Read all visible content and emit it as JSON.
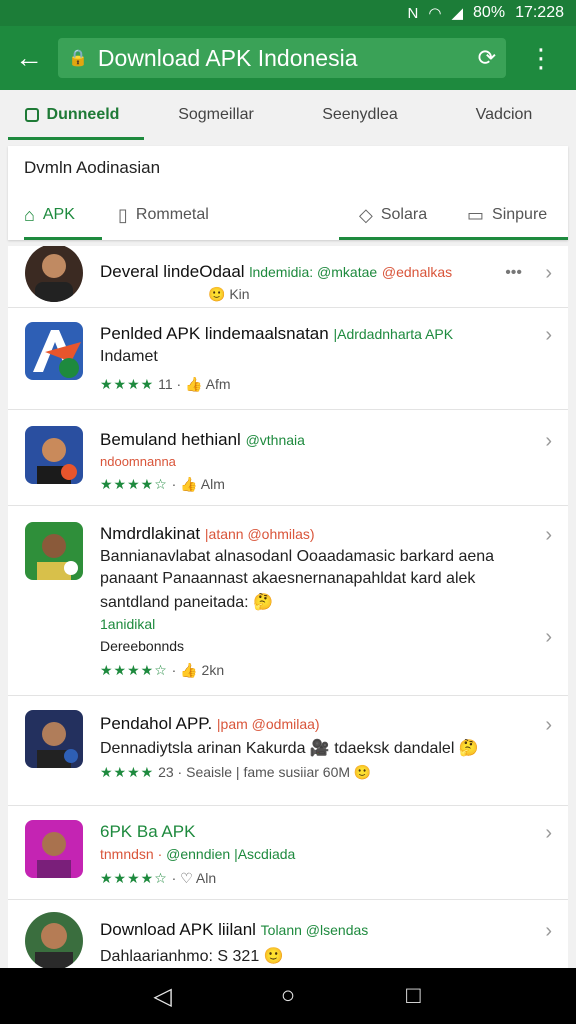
{
  "status": {
    "battery": "80%",
    "time": "17:228"
  },
  "toolbar": {
    "url": "Download APK Indonesia"
  },
  "top_tabs": [
    "Dunneeld",
    "Sogmeillar",
    "Seenydlea",
    "Vadcion"
  ],
  "card": {
    "title": "Dvmln Aodinasian",
    "sub_tabs": [
      "APK",
      "Rommetal",
      "Solara",
      "Sinpure"
    ]
  },
  "items": [
    {
      "title": "Deveral lindeOdaal",
      "dev": "lndemidia: @mkatae",
      "dev2": "@ednalkas",
      "meta": "Kin"
    },
    {
      "title": "Penlded APK lindemaalsnatan",
      "dev": "|Adrdadnharta APK",
      "desc": "Indamet",
      "stars": "★★★★",
      "rating": "11 ·",
      "meta": "Afm"
    },
    {
      "title": "Bemuland hethianl",
      "dev": "@vthnaia",
      "red": "ndoomnanna",
      "stars": "★★★★☆",
      "rating": "·",
      "meta": "Alm"
    },
    {
      "title": "Nmdrdlakinat",
      "dev2": "|atann @ohmilas)",
      "desc1": "Bannianavlabat alnasodanl Ooaadamasic barkard aena",
      "desc2": "panaant Panaannast akaesnernanapahldat kard alek",
      "desc3": "santdland paneitada:",
      "green": "1anidikal",
      "desc4": "Dereebonnds",
      "stars": "★★★★☆",
      "rating": "·",
      "meta": "2kn"
    },
    {
      "title": "Pendahol APP.",
      "dev2": "|pam @odmilaa)",
      "desc": "Dennadiytsla arinan Kakurda",
      "desc_b": "tdaeksk dandalel",
      "stars": "★★★★",
      "rating": "23 ·",
      "meta": "Seaisle | fame susiiar 60M"
    },
    {
      "title": "6PK Ba APK",
      "red": "tnmndsn ·",
      "dev": "@enndien |Ascdiada",
      "stars": "★★★★☆",
      "rating": "·",
      "meta": "Aln"
    },
    {
      "title": "Download APK liilanl",
      "dev": "Tolann @lsendas",
      "desc": "Dahlaarianhmo: S 321"
    }
  ],
  "colors": {
    "primary": "#1e8a3e",
    "accent_red": "#d9553a"
  }
}
